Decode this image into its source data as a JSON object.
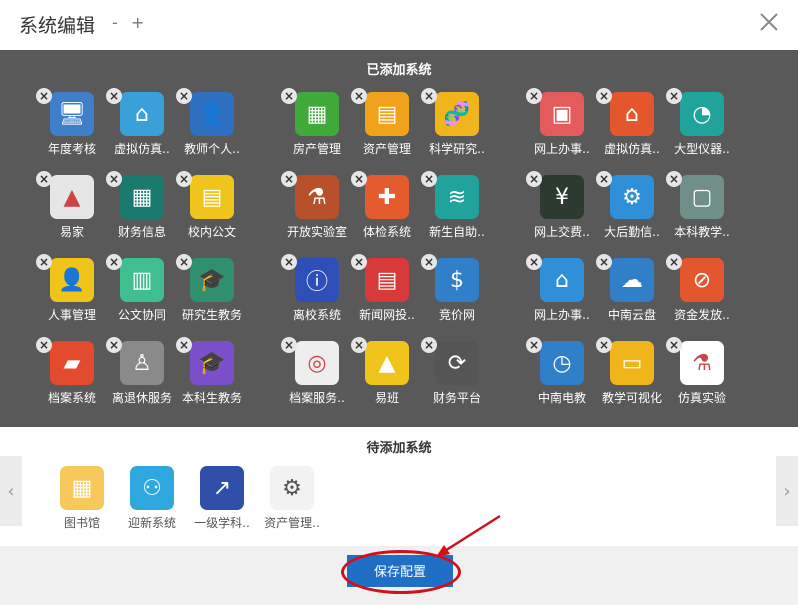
{
  "dialog": {
    "title": "系统编辑",
    "minus": "-",
    "plus": "+"
  },
  "added": {
    "title": "已添加系统",
    "items": [
      {
        "label": "年度考核",
        "color": "#3f7ec9",
        "glyph": "🖥"
      },
      {
        "label": "虚拟仿真..",
        "color": "#3aa1d8",
        "glyph": "⌂"
      },
      {
        "label": "教师个人..",
        "color": "#2f6fbf",
        "glyph": "👤"
      },
      {
        "label": "房产管理",
        "color": "#3faa3a",
        "glyph": "▦"
      },
      {
        "label": "资产管理",
        "color": "#f0a21b",
        "glyph": "▤"
      },
      {
        "label": "科学研究..",
        "color": "#f0b51b",
        "glyph": "🧬"
      },
      {
        "label": "网上办事..",
        "color": "#e45b5b",
        "glyph": "▣"
      },
      {
        "label": "虚拟仿真..",
        "color": "#e4572e",
        "glyph": "⌂"
      },
      {
        "label": "大型仪器..",
        "color": "#1fa39a",
        "glyph": "◔"
      },
      {
        "label": "易家",
        "color": "#e6e6e6",
        "glyph": "▲"
      },
      {
        "label": "财务信息",
        "color": "#1b7a6e",
        "glyph": "▦"
      },
      {
        "label": "校内公文",
        "color": "#f0c41b",
        "glyph": "▤"
      },
      {
        "label": "开放实验室",
        "color": "#b8512a",
        "glyph": "⚗"
      },
      {
        "label": "体检系统",
        "color": "#e45b2e",
        "glyph": "✚"
      },
      {
        "label": "新生自助..",
        "color": "#1fa39a",
        "glyph": "≋"
      },
      {
        "label": "网上交费..",
        "color": "#2c3a30",
        "glyph": "¥"
      },
      {
        "label": "大后勤信..",
        "color": "#2f8fd8",
        "glyph": "⚙"
      },
      {
        "label": "本科教学..",
        "color": "#6f8f88",
        "glyph": "▢"
      },
      {
        "label": "人事管理",
        "color": "#f0c41b",
        "glyph": "👤"
      },
      {
        "label": "公文协同",
        "color": "#3fbf8f",
        "glyph": "▥"
      },
      {
        "label": "研究生教务",
        "color": "#2f8f6f",
        "glyph": "🎓"
      },
      {
        "label": "离校系统",
        "color": "#2f4fb8",
        "glyph": "ⓘ"
      },
      {
        "label": "新闻网投..",
        "color": "#d83a3a",
        "glyph": "▤"
      },
      {
        "label": "竞价网",
        "color": "#2f7fc9",
        "glyph": "$"
      },
      {
        "label": "网上办事..",
        "color": "#2f8fd8",
        "glyph": "⌂"
      },
      {
        "label": "中南云盘",
        "color": "#2f7fc9",
        "glyph": "☁"
      },
      {
        "label": "资金发放..",
        "color": "#e4572e",
        "glyph": "⊘"
      },
      {
        "label": "档案系统",
        "color": "#e44a2e",
        "glyph": "▰"
      },
      {
        "label": "离退休服务",
        "color": "#8a8a8a",
        "glyph": "♙"
      },
      {
        "label": "本科生教务",
        "color": "#7a4fc9",
        "glyph": "🎓"
      },
      {
        "label": "档案服务..",
        "color": "#eeeeee",
        "glyph": "◎"
      },
      {
        "label": "易班",
        "color": "#f0c41b",
        "glyph": "▲"
      },
      {
        "label": "财务平台",
        "color": "#555555",
        "glyph": "⟳"
      },
      {
        "label": "中南电教",
        "color": "#2f7fc9",
        "glyph": "◷"
      },
      {
        "label": "教学可视化",
        "color": "#f0b51b",
        "glyph": "▭"
      },
      {
        "label": "仿真实验",
        "color": "#ffffff",
        "glyph": "⚗"
      }
    ]
  },
  "pending": {
    "title": "待添加系统",
    "items": [
      {
        "label": "图书馆",
        "color": "#f6c95a",
        "glyph": "▦"
      },
      {
        "label": "迎新系统",
        "color": "#2fa8e0",
        "glyph": "⚇"
      },
      {
        "label": "一级学科..",
        "color": "#2f4fa8",
        "glyph": "↗"
      },
      {
        "label": "资产管理..",
        "color": "#f2f2f2",
        "glyph": "⚙"
      }
    ]
  },
  "nav": {
    "prev": "‹",
    "next": "›"
  },
  "footer": {
    "save_label": "保存配置"
  },
  "icons": {
    "close": "close-icon",
    "remove": "remove-icon",
    "arrow_left": "chevron-left-icon",
    "arrow_right": "chevron-right-icon"
  }
}
